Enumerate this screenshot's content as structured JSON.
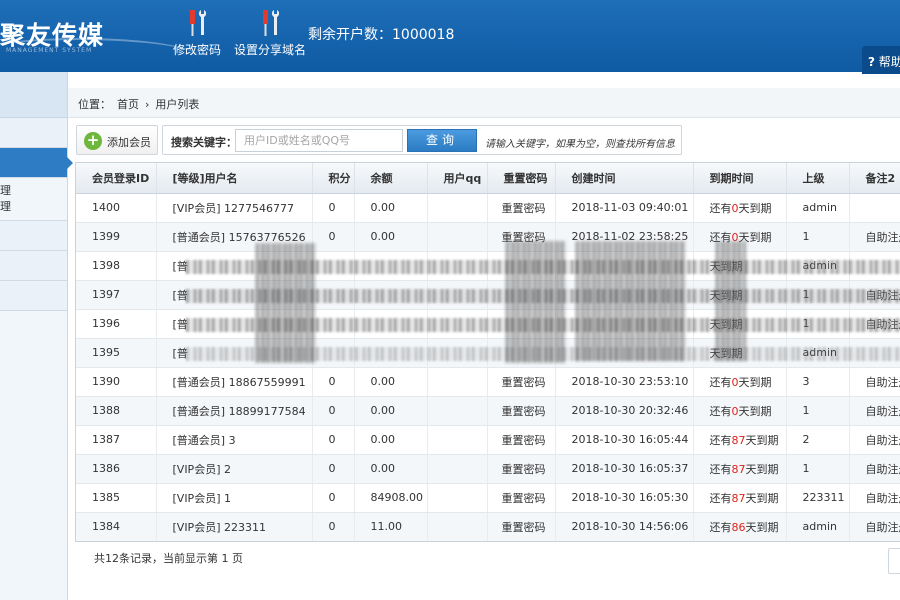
{
  "header": {
    "logo": "聚友传媒",
    "logo_sub": "MANAGEMENT SYSTEM",
    "tools": [
      {
        "label": "修改密码",
        "icon": "screwdriver-wrench-icon"
      },
      {
        "label": "设置分享域名",
        "icon": "screwdriver-wrench-icon"
      }
    ],
    "remaining_label": "剩余开户数：1000018",
    "help_label": "帮助"
  },
  "sidebar": {
    "sub_items": [
      "理",
      "理"
    ]
  },
  "breadcrumb": {
    "prefix": "位置：",
    "home": "首页",
    "separator": "›",
    "current": "用户列表"
  },
  "toolbar": {
    "add_label": "添加会员",
    "search_label": "搜索关键字：",
    "search_placeholder": "用户ID或姓名或QQ号",
    "search_value": "",
    "query_label": "查询",
    "hint": "请输入关键字，如果为空，则查找所有信息"
  },
  "table": {
    "columns": [
      "会员登录ID",
      "[等级]用户名",
      "积分",
      "余额",
      "用户qq",
      "重置密码",
      "创建时间",
      "到期时间",
      "上级",
      "备注2"
    ],
    "rows": [
      {
        "id": "1400",
        "name": "[VIP会员] 1277546777",
        "points": "0",
        "balance": "0.00",
        "qq": "",
        "reset": "重置密码",
        "created": "2018-11-03 09:40:01",
        "exp_pre": "还有",
        "exp_days": "0",
        "exp_post": "天到期",
        "parent": "admin",
        "note": ""
      },
      {
        "id": "1399",
        "name": "[普通会员] 15763776526",
        "points": "0",
        "balance": "0.00",
        "qq": "",
        "reset": "重置密码",
        "created": "2018-11-02 23:58:25",
        "exp_pre": "还有",
        "exp_days": "0",
        "exp_post": "天到期",
        "parent": "1",
        "note": "自助注册"
      },
      {
        "id": "1398",
        "name": "[普",
        "points": "",
        "balance": "",
        "qq": "",
        "reset": "",
        "created": "",
        "exp_pre": "",
        "exp_days": "",
        "exp_post": "天到期",
        "parent": "admin",
        "note": ""
      },
      {
        "id": "1397",
        "name": "[普",
        "points": "",
        "balance": "",
        "qq": "",
        "reset": "",
        "created": "",
        "exp_pre": "",
        "exp_days": "",
        "exp_post": "天到期",
        "parent": "1",
        "note": "自助注册"
      },
      {
        "id": "1396",
        "name": "[普",
        "points": "",
        "balance": "",
        "qq": "",
        "reset": "",
        "created": "",
        "exp_pre": "",
        "exp_days": "",
        "exp_post": "天到期",
        "parent": "1",
        "note": "自助注册"
      },
      {
        "id": "1395",
        "name": "[普",
        "points": "",
        "balance": "",
        "qq": "",
        "reset": "",
        "created": "",
        "exp_pre": "",
        "exp_days": "",
        "exp_post": "天到期",
        "parent": "admin",
        "note": ""
      },
      {
        "id": "1390",
        "name": "[普通会员] 18867559991",
        "points": "0",
        "balance": "0.00",
        "qq": "",
        "reset": "重置密码",
        "created": "2018-10-30 23:53:10",
        "exp_pre": "还有",
        "exp_days": "0",
        "exp_post": "天到期",
        "parent": "3",
        "note": "自助注册"
      },
      {
        "id": "1388",
        "name": "[普通会员] 18899177584",
        "points": "0",
        "balance": "0.00",
        "qq": "",
        "reset": "重置密码",
        "created": "2018-10-30 20:32:46",
        "exp_pre": "还有",
        "exp_days": "0",
        "exp_post": "天到期",
        "parent": "1",
        "note": "自助注册"
      },
      {
        "id": "1387",
        "name": "[普通会员] 3",
        "points": "0",
        "balance": "0.00",
        "qq": "",
        "reset": "重置密码",
        "created": "2018-10-30 16:05:44",
        "exp_pre": "还有",
        "exp_days": "87",
        "exp_post": "天到期",
        "parent": "2",
        "note": "自助注册"
      },
      {
        "id": "1386",
        "name": "[VIP会员] 2",
        "points": "0",
        "balance": "0.00",
        "qq": "",
        "reset": "重置密码",
        "created": "2018-10-30 16:05:37",
        "exp_pre": "还有",
        "exp_days": "87",
        "exp_post": "天到期",
        "parent": "1",
        "note": "自助注册"
      },
      {
        "id": "1385",
        "name": "[VIP会员] 1",
        "points": "0",
        "balance": "84908.00",
        "qq": "",
        "reset": "重置密码",
        "created": "2018-10-30 16:05:30",
        "exp_pre": "还有",
        "exp_days": "87",
        "exp_post": "天到期",
        "parent": "223311",
        "note": "自助注册"
      },
      {
        "id": "1384",
        "name": "[VIP会员] 223311",
        "points": "0",
        "balance": "11.00",
        "qq": "",
        "reset": "重置密码",
        "created": "2018-10-30 14:56:06",
        "exp_pre": "还有",
        "exp_days": "86",
        "exp_post": "天到期",
        "parent": "admin",
        "note": "自助注册"
      }
    ]
  },
  "footer": {
    "summary": "共12条记录，当前显示第 1 页"
  }
}
